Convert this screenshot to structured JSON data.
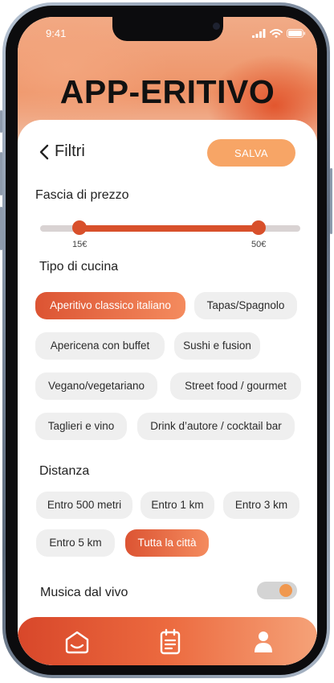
{
  "status_bar": {
    "time": "9:41"
  },
  "app": {
    "title": "APP-ERITIVO"
  },
  "header": {
    "back_label": "Filtri",
    "save_label": "SALVA"
  },
  "price": {
    "title": "Fascia di prezzo",
    "min_label": "15€",
    "max_label": "50€",
    "selected_min_fraction": 0.15,
    "selected_max_fraction": 0.84
  },
  "cuisine": {
    "title": "Tipo di cucina",
    "options": [
      {
        "label": "Aperitivo classico italiano",
        "selected": true
      },
      {
        "label": "Tapas/Spagnolo",
        "selected": false
      },
      {
        "label": "Apericena con buffet",
        "selected": false
      },
      {
        "label": "Sushi e fusion",
        "selected": false
      },
      {
        "label": "Vegano/vegetariano",
        "selected": false
      },
      {
        "label": "Street food / gourmet",
        "selected": false
      },
      {
        "label": "Taglieri e vino",
        "selected": false
      },
      {
        "label": "Drink d’autore / cocktail bar",
        "selected": false
      }
    ]
  },
  "distance": {
    "title": "Distanza",
    "options": [
      {
        "label": "Entro 500 metri",
        "selected": false
      },
      {
        "label": "Entro 1 km",
        "selected": false
      },
      {
        "label": "Entro 3 km",
        "selected": false
      },
      {
        "label": "Entro 5 km",
        "selected": false
      },
      {
        "label": "Tutta la città",
        "selected": true
      }
    ]
  },
  "live_music": {
    "title": "Musica dal vivo",
    "enabled": true
  },
  "bottom_nav": {
    "items": [
      {
        "icon": "home-icon"
      },
      {
        "icon": "calendar-icon"
      },
      {
        "icon": "user-icon"
      }
    ]
  },
  "colors": {
    "accent": "#d8502b",
    "save_button": "#f7a566",
    "chip_bg": "#efefef",
    "toggle_knob": "#f0984f"
  }
}
